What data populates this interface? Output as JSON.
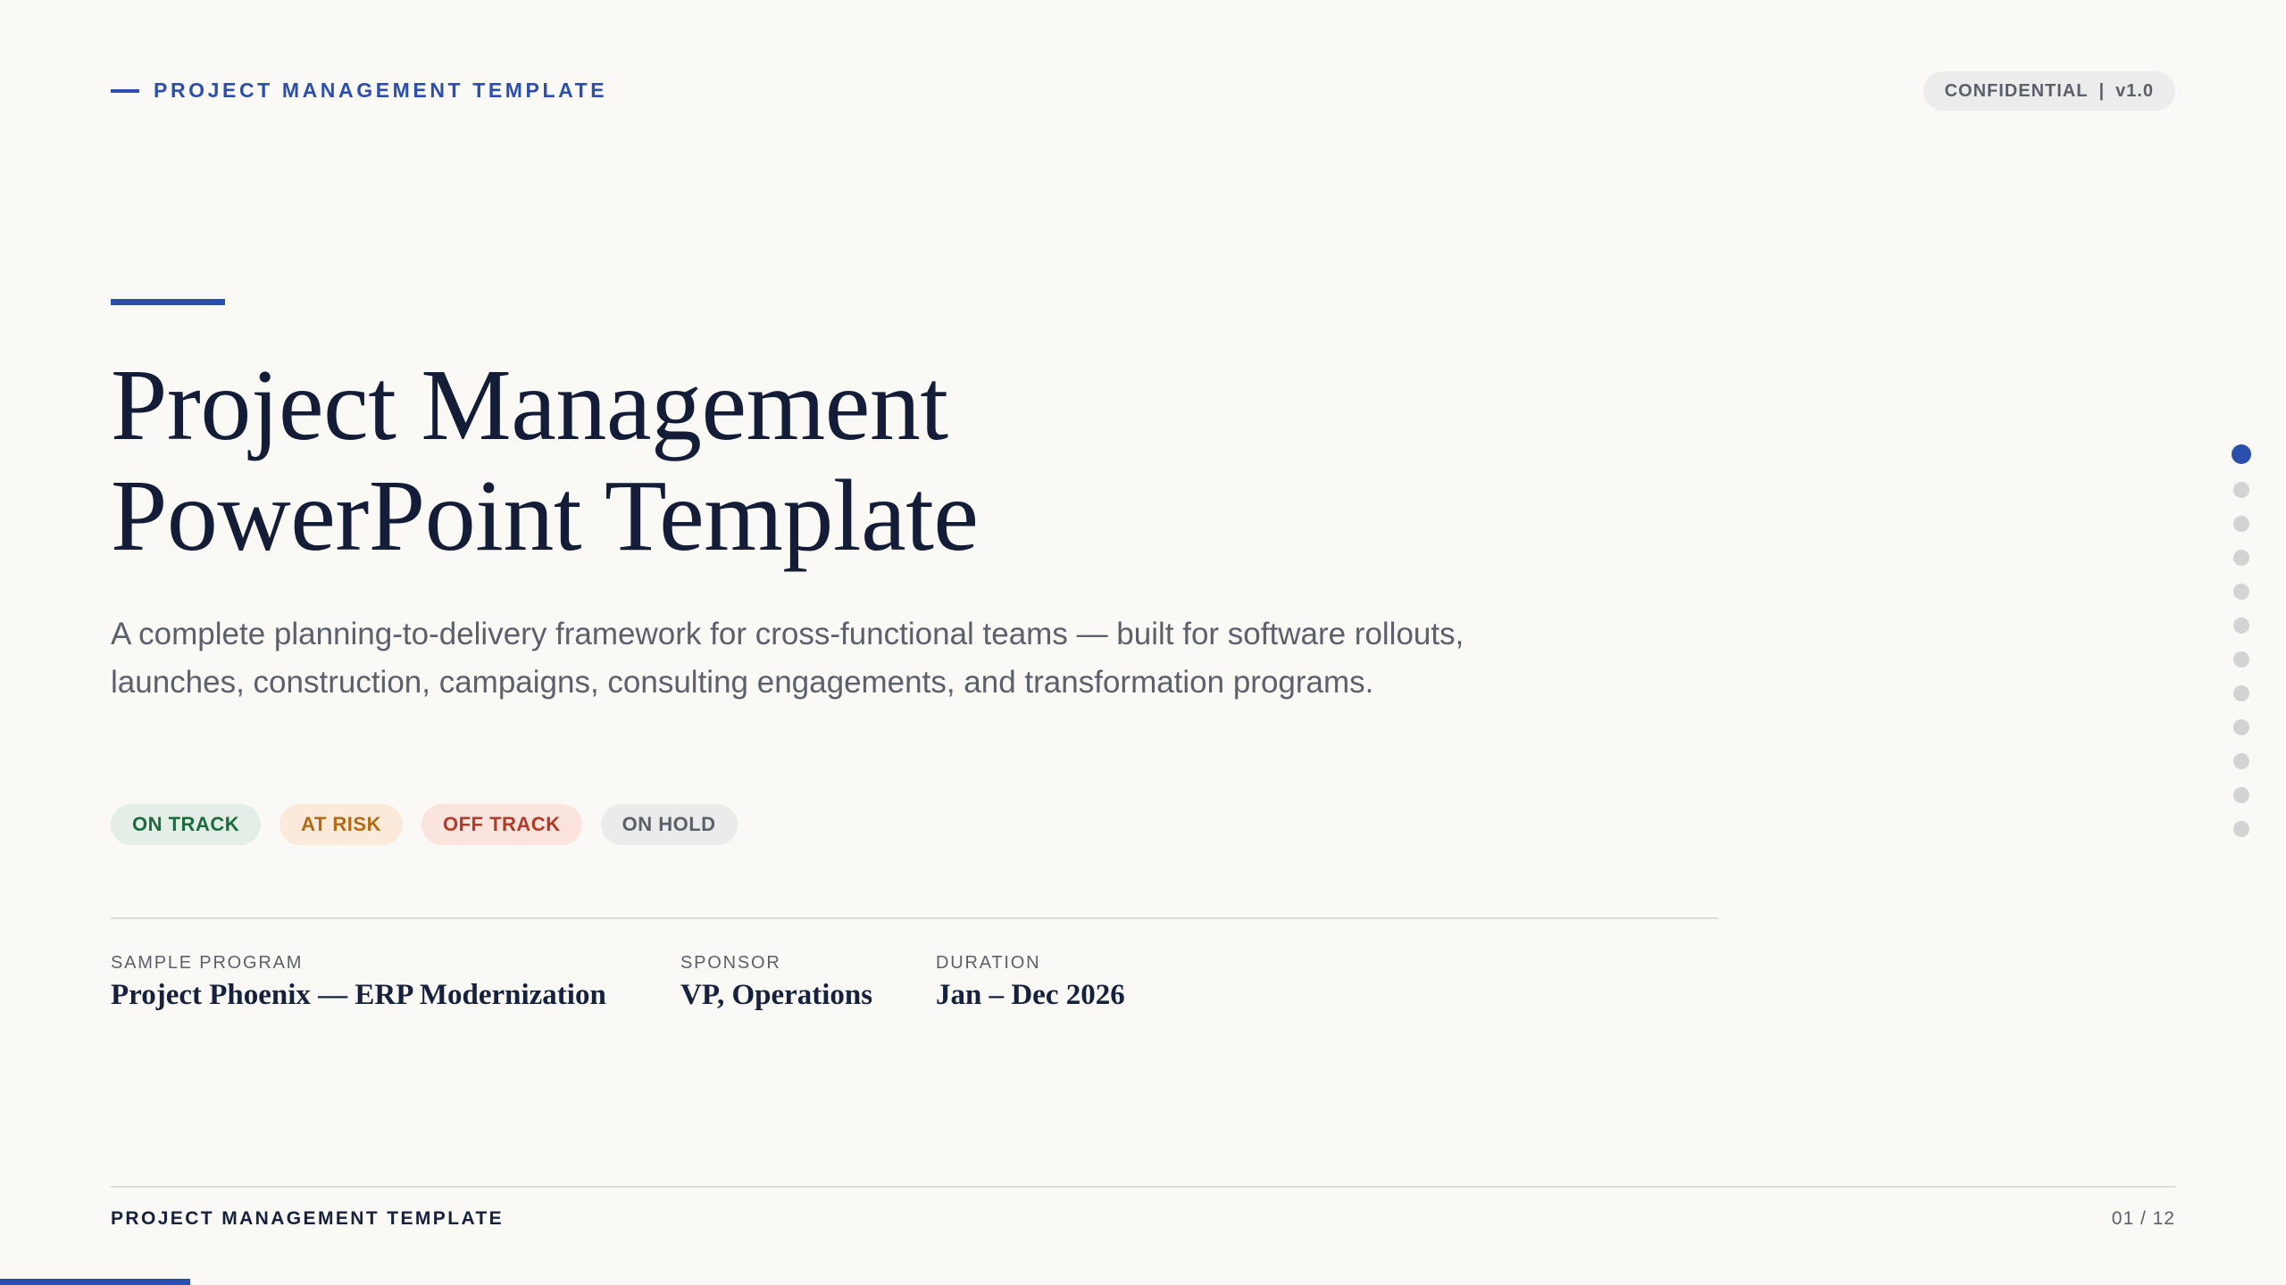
{
  "header": {
    "kicker": "PROJECT MANAGEMENT TEMPLATE",
    "badge_label": "CONFIDENTIAL",
    "badge_separator": "|",
    "badge_version": "v1.0"
  },
  "hero": {
    "title_line1": "Project Management",
    "title_line2": "PowerPoint Template",
    "description": "A complete planning-to-delivery framework for cross-functional teams — built for software rollouts, launches, construction, campaigns, consulting engagements, and transformation programs."
  },
  "status_pills": {
    "on_track": "ON TRACK",
    "at_risk": "AT RISK",
    "off_track": "OFF TRACK",
    "on_hold": "ON HOLD"
  },
  "meta": {
    "program": {
      "label": "SAMPLE PROGRAM",
      "value": "Project Phoenix — ERP Modernization"
    },
    "sponsor": {
      "label": "SPONSOR",
      "value": "VP, Operations"
    },
    "duration": {
      "label": "DURATION",
      "value": "Jan – Dec 2026"
    }
  },
  "navigation": {
    "total_slides": 12,
    "current_slide": 1
  },
  "footer": {
    "title": "PROJECT MANAGEMENT TEMPLATE",
    "page_number": "01 / 12"
  },
  "progress": {
    "fraction": 0.0833
  },
  "colors": {
    "accent": "#2a4fad",
    "on_track": "#1d6b3c",
    "at_risk": "#b26a14",
    "off_track": "#b23a28",
    "on_hold": "#5a5f69"
  }
}
